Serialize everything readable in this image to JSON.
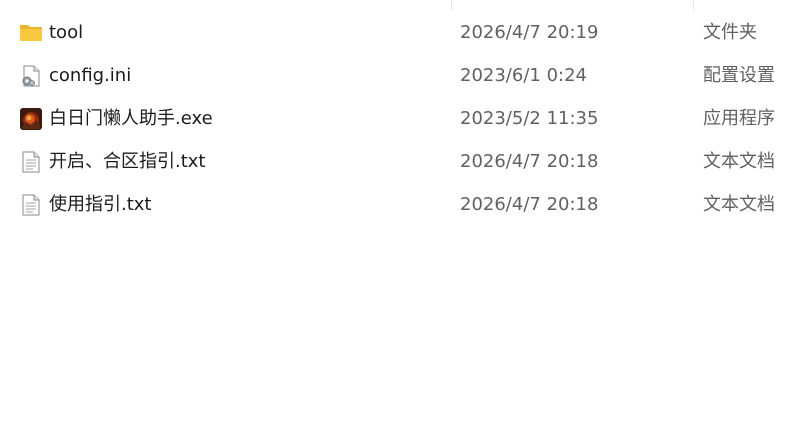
{
  "files": [
    {
      "name": "tool",
      "modified": "2026/4/7 20:19",
      "type": "文件夹",
      "icon": "folder-icon"
    },
    {
      "name": "config.ini",
      "modified": "2023/6/1 0:24",
      "type": "配置设置",
      "icon": "config-file-icon"
    },
    {
      "name": "白日门懒人助手.exe",
      "modified": "2023/5/2 11:35",
      "type": "应用程序",
      "icon": "app-exe-icon"
    },
    {
      "name": "开启、合区指引.txt",
      "modified": "2026/4/7 20:18",
      "type": "文本文档",
      "icon": "text-file-icon"
    },
    {
      "name": "使用指引.txt",
      "modified": "2026/4/7 20:18",
      "type": "文本文档",
      "icon": "text-file-icon"
    }
  ],
  "colors": {
    "name_text": "#1b1b1b",
    "secondary_text": "#616161",
    "folder": "#f8c93f",
    "divider": "#e5e5e5"
  }
}
